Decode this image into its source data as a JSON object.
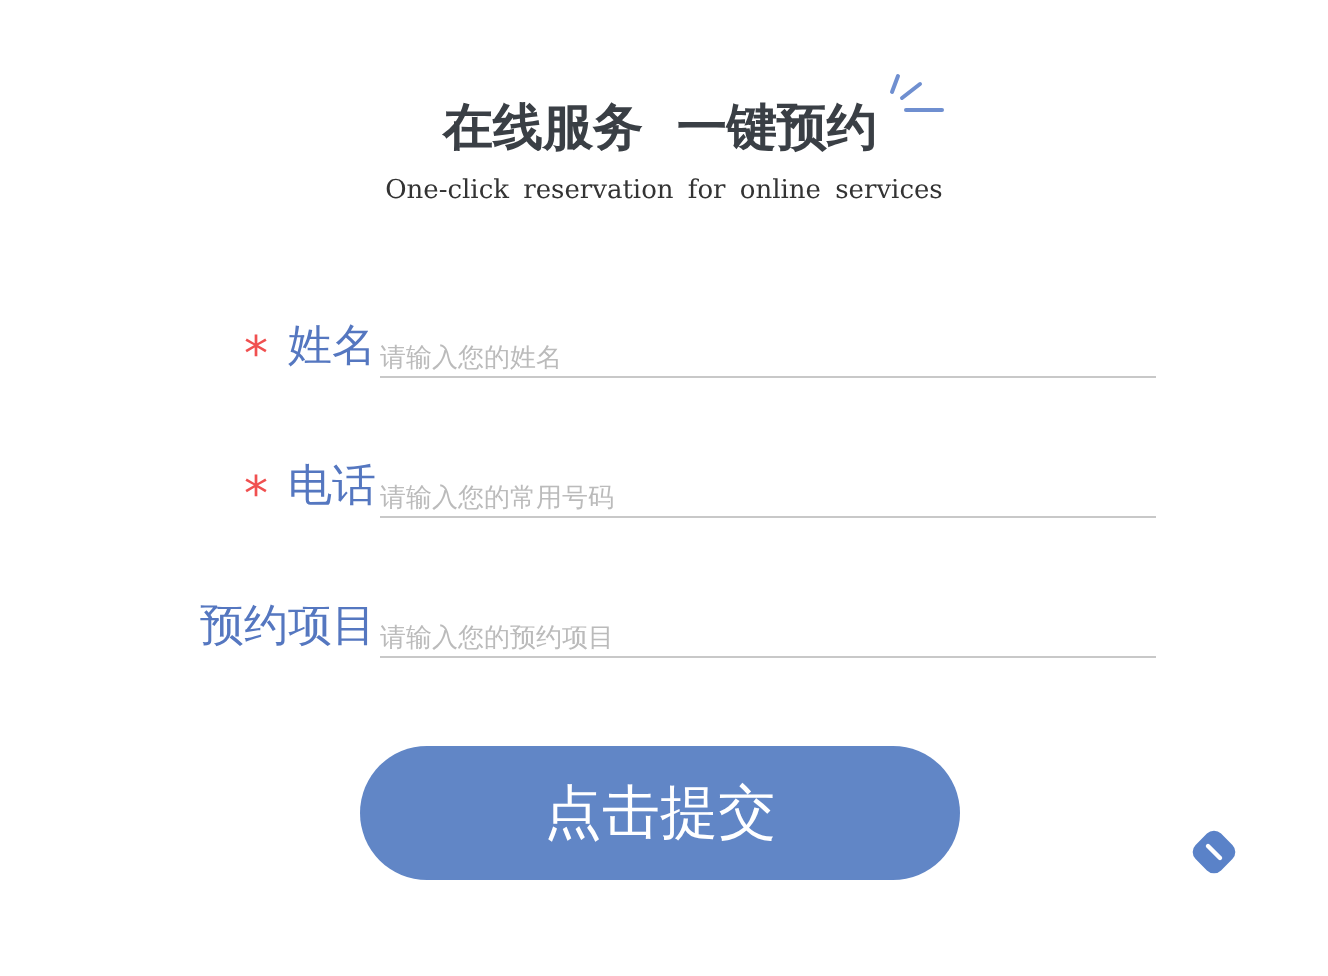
{
  "title": "在线服务  一键预约",
  "subtitle": "One-click reservation for online services",
  "fields": [
    {
      "label": "姓名",
      "placeholder": "请输入您的姓名",
      "required_mark": "*"
    },
    {
      "label": "电话",
      "placeholder": "请输入您的常用号码",
      "required_mark": "*"
    },
    {
      "label": "预约项目",
      "placeholder": "请输入您的预约项目"
    }
  ],
  "submit": "点击提交"
}
